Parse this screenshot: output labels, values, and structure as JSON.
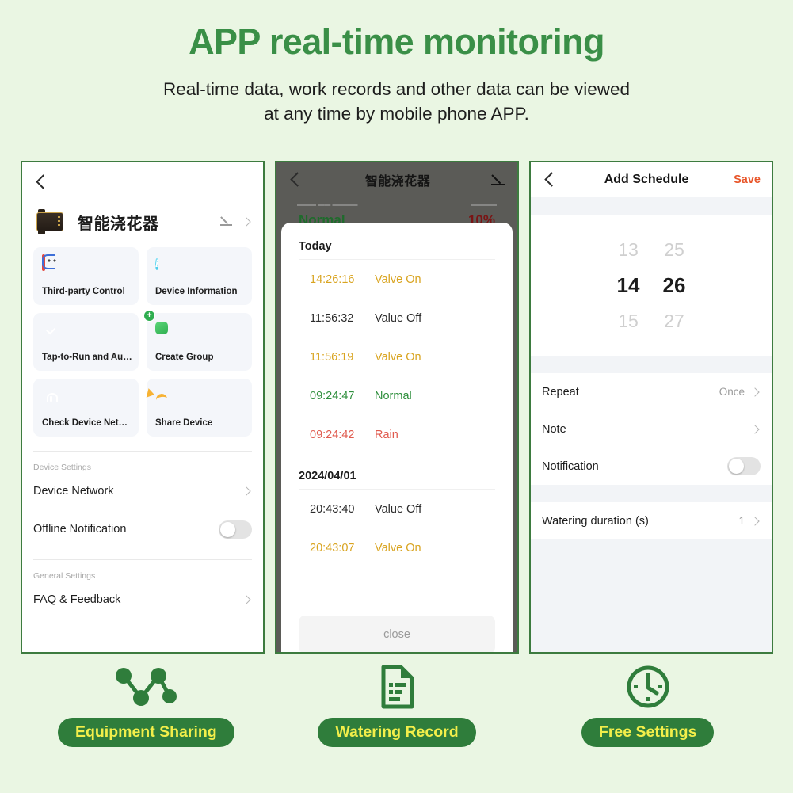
{
  "hero": {
    "title": "APP real-time monitoring",
    "subtitle_line1": "Real-time data, work records and other data can be viewed",
    "subtitle_line2": "at any time by mobile phone APP.",
    "title_color": "#3a8f47"
  },
  "theme": {
    "background": "#eaf6e3",
    "panel_border": "#3d7b3f",
    "pill_bg": "#2f7d3b",
    "pill_text": "#f2ee4a",
    "save_accent": "#e8562a"
  },
  "panel_device": {
    "back_icon": "chevron-left-icon",
    "device_name": "智能浇花器",
    "edit_icon": "pencil-icon",
    "chevron_icon": "chevron-right-icon",
    "cards": [
      {
        "label": "Third-party Control",
        "icon": "third-party-control-icon"
      },
      {
        "label": "Device Information",
        "icon": "info-icon"
      },
      {
        "label": "Tap-to-Run and Auto...",
        "icon": "tap-to-run-icon"
      },
      {
        "label": "Create Group",
        "icon": "create-group-icon"
      },
      {
        "label": "Check Device Network",
        "icon": "network-check-icon"
      },
      {
        "label": "Share Device",
        "icon": "share-icon"
      }
    ],
    "sections": [
      {
        "heading": "Device Settings",
        "rows": [
          {
            "label": "Device Network",
            "type": "chevron"
          },
          {
            "label": "Offline Notification",
            "type": "toggle",
            "value": "off"
          }
        ]
      },
      {
        "heading": "General Settings",
        "rows": [
          {
            "label": "FAQ & Feedback",
            "type": "chevron"
          }
        ]
      }
    ]
  },
  "panel_record": {
    "back_icon": "chevron-left-icon",
    "title": "智能浇花器",
    "edit_icon": "pencil-icon",
    "status_left": "Normal",
    "status_right": "10%",
    "groups": [
      {
        "day_label": "Today",
        "entries": [
          {
            "time": "14:26:16",
            "event": "Valve On",
            "color": "amber"
          },
          {
            "time": "11:56:32",
            "event": "Value Off",
            "color": "dark"
          },
          {
            "time": "11:56:19",
            "event": "Valve On",
            "color": "amber"
          },
          {
            "time": "09:24:47",
            "event": "Normal",
            "color": "green"
          },
          {
            "time": "09:24:42",
            "event": "Rain",
            "color": "red"
          }
        ]
      },
      {
        "day_label": "2024/04/01",
        "entries": [
          {
            "time": "20:43:40",
            "event": "Value Off",
            "color": "dark"
          },
          {
            "time": "20:43:07",
            "event": "Valve On",
            "color": "amber"
          }
        ]
      }
    ],
    "close_label": "close"
  },
  "panel_schedule": {
    "back_icon": "chevron-left-icon",
    "title": "Add Schedule",
    "save_label": "Save",
    "picker": {
      "above": {
        "hour": "13",
        "minute": "25"
      },
      "selected": {
        "hour": "14",
        "minute": "26"
      },
      "below": {
        "hour": "15",
        "minute": "27"
      }
    },
    "rows": [
      {
        "label": "Repeat",
        "value": "Once",
        "type": "chevron"
      },
      {
        "label": "Note",
        "value": "",
        "type": "chevron"
      },
      {
        "label": "Notification",
        "value": "off",
        "type": "toggle"
      },
      {
        "label": "Watering duration (s)",
        "value": "1",
        "type": "chevron"
      }
    ]
  },
  "features": [
    {
      "label": "Equipment Sharing",
      "icon": "share-network-icon"
    },
    {
      "label": "Watering Record",
      "icon": "document-lines-icon"
    },
    {
      "label": "Free Settings",
      "icon": "clock-icon"
    }
  ]
}
